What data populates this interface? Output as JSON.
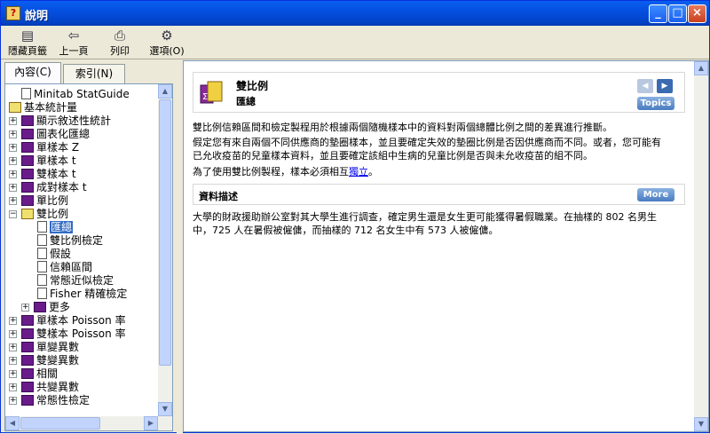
{
  "window": {
    "title": "說明"
  },
  "toolbar": {
    "items": [
      {
        "label": "隱藏頁籤",
        "icon": "hide-tabs-icon"
      },
      {
        "label": "上一頁",
        "icon": "back-arrow-icon"
      },
      {
        "label": "列印",
        "icon": "printer-icon"
      },
      {
        "label": "選項(O)",
        "icon": "options-icon"
      }
    ]
  },
  "tabs": {
    "contents": "內容(C)",
    "index": "索引(N)"
  },
  "tree": {
    "items": [
      {
        "label": "Minitab StatGuide",
        "type": "page"
      },
      {
        "label": "基本統計量",
        "type": "book-open"
      },
      {
        "label": "顯示敘述性統計",
        "type": "book"
      },
      {
        "label": "圖表化匯總",
        "type": "book"
      },
      {
        "label": "單樣本 Z",
        "type": "book"
      },
      {
        "label": "單樣本 t",
        "type": "book"
      },
      {
        "label": "雙樣本 t",
        "type": "book"
      },
      {
        "label": "成對樣本 t",
        "type": "book"
      },
      {
        "label": "單比例",
        "type": "book"
      },
      {
        "label": "雙比例",
        "type": "book-open"
      },
      {
        "label": "匯總",
        "type": "page"
      },
      {
        "label": "雙比例檢定",
        "type": "page"
      },
      {
        "label": "假設",
        "type": "page"
      },
      {
        "label": "信賴區間",
        "type": "page"
      },
      {
        "label": "常態近似檢定",
        "type": "page"
      },
      {
        "label": "Fisher 精確檢定",
        "type": "page"
      },
      {
        "label": "更多",
        "type": "book"
      },
      {
        "label": "單樣本 Poisson 率",
        "type": "book"
      },
      {
        "label": "雙樣本 Poisson 率",
        "type": "book"
      },
      {
        "label": "單變異數",
        "type": "book"
      },
      {
        "label": "雙變異數",
        "type": "book"
      },
      {
        "label": "相關",
        "type": "book"
      },
      {
        "label": "共變異數",
        "type": "book"
      },
      {
        "label": "常態性檢定",
        "type": "book"
      }
    ]
  },
  "content": {
    "title": "雙比例",
    "subtitle": "匯總",
    "topics_label": "Topics",
    "more_label": "More",
    "para1": "雙比例信賴區間和檢定製程用於根據兩個隨機樣本中的資料對兩個總體比例之間的差異進行推斷。",
    "para2a": "假定您有來自兩個不同供應商的墊圈樣本，並且要確定失效的墊圈比例是否因供應商而不同。或者，您可能有",
    "para2b": "已允收疫苗的兒童樣本資料，並且要確定該組中生病的兒童比例是否與未允收疫苗的組不同。",
    "para3_pre": "為了使用雙比例製程，樣本必須相互",
    "para3_link": "獨立",
    "para3_post": "。",
    "section_title": "資料描述",
    "para4a": "大學的財政援助辦公室對其大學生進行調查，確定男生還是女生更可能獲得暑假職業。在抽樣的 802 名男生",
    "para4b": "中，725 人在暑假被僱傭，而抽樣的 712 名女生中有 573 人被僱傭。"
  }
}
